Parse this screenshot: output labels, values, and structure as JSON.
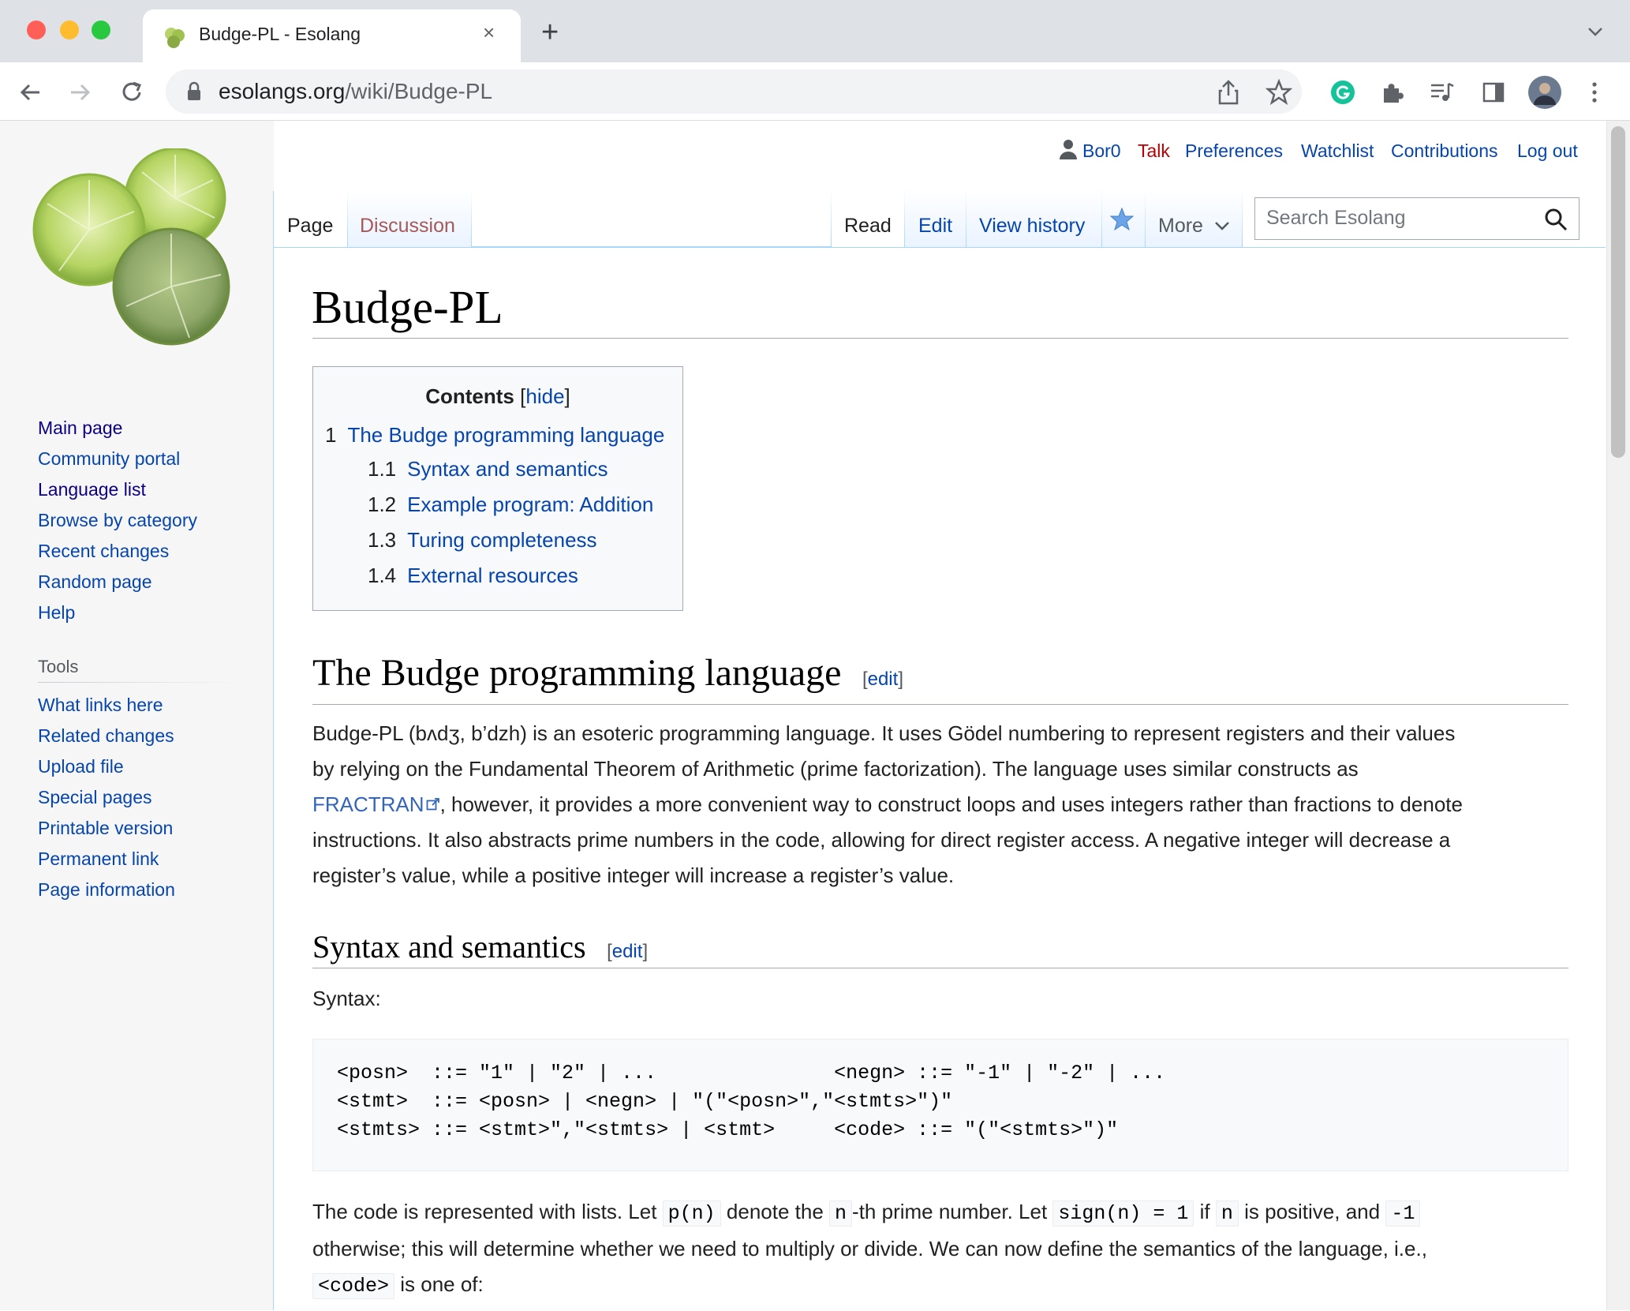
{
  "browser": {
    "tab_title": "Budge-PL - Esolang",
    "url_domain": "esolangs.org",
    "url_path": "/wiki/Budge-PL",
    "new_tab_symbol": "+",
    "close_tab_symbol": "×"
  },
  "personal": {
    "username": "Bor0",
    "talk": "Talk",
    "preferences": "Preferences",
    "watchlist": "Watchlist",
    "contributions": "Contributions",
    "logout": "Log out"
  },
  "tabs": {
    "page": "Page",
    "discussion": "Discussion",
    "read": "Read",
    "edit": "Edit",
    "view_history": "View history",
    "more": "More"
  },
  "search": {
    "placeholder": "Search Esolang"
  },
  "navigation": [
    "Main page",
    "Community portal",
    "Language list",
    "Browse by category",
    "Recent changes",
    "Random page",
    "Help"
  ],
  "tools": {
    "heading": "Tools",
    "items": [
      "What links here",
      "Related changes",
      "Upload file",
      "Special pages",
      "Printable version",
      "Permanent link",
      "Page information"
    ]
  },
  "article": {
    "title": "Budge-PL",
    "toc": {
      "title": "Contents",
      "toggle": "hide",
      "items": [
        {
          "num": "1",
          "label": "The Budge programming language"
        },
        {
          "num": "1.1",
          "label": "Syntax and semantics"
        },
        {
          "num": "1.2",
          "label": "Example program: Addition"
        },
        {
          "num": "1.3",
          "label": "Turing completeness"
        },
        {
          "num": "1.4",
          "label": "External resources"
        }
      ]
    },
    "section1": {
      "heading": "The Budge programming language",
      "edit": "edit",
      "para_l1": "Budge-PL (bʌdʒ, b’dzh) is an esoteric programming language. It uses Gödel numbering to represent registers and their values",
      "para_l2": "by relying on the Fundamental Theorem of Arithmetic (prime factorization). The language uses similar constructs as",
      "para_link": "FRACTRAN",
      "para_l3": ", however, it provides a more convenient way to construct loops and uses integers rather than fractions to denote",
      "para_l4": "instructions. It also abstracts prime numbers in the code, allowing for direct register access. A negative integer will decrease a",
      "para_l5": "register’s value, while a positive integer will increase a register’s value."
    },
    "section2": {
      "heading": "Syntax and semantics",
      "edit": "edit",
      "syntax_label": "Syntax:",
      "code_lines": [
        "<posn>  ::= \"1\" | \"2\" | ...               <negn> ::= \"-1\" | \"-2\" | ...",
        "<stmt>  ::= <posn> | <negn> | \"(\"<posn>\",\"<stmts>\")\"",
        "<stmts> ::= <stmt>\",\"<stmts> | <stmt>     <code> ::= \"(\"<stmts>\")\""
      ],
      "sem_a": "The code is represented with lists. Let ",
      "sem_code1": "p(n)",
      "sem_b": " denote the ",
      "sem_code2": "n",
      "sem_c": "-th prime number. Let ",
      "sem_code3": "sign(n) = 1",
      "sem_d": " if ",
      "sem_code4": "n",
      "sem_e": " is positive, and ",
      "sem_code5": "-1",
      "sem_l2": "otherwise; this will determine whether we need to multiply or divide. We can now define the semantics of the language, i.e.,",
      "sem_code6": "<code>",
      "sem_l3": " is one of:"
    }
  },
  "colors": {
    "link": "#0645ad",
    "visited": "#0b0080",
    "new_link": "#ba0000",
    "chrome_tabbar": "#dee1e6"
  }
}
